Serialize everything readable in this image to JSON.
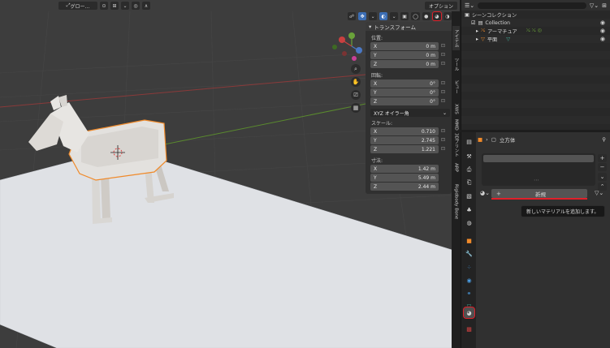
{
  "viewport_header": {
    "transform_orientation": "グロー...",
    "options_label": "オプション"
  },
  "npanel": {
    "title": "トランスフォーム",
    "location_label": "位置:",
    "location": [
      {
        "axis": "X",
        "value": "0 m"
      },
      {
        "axis": "Y",
        "value": "0 m"
      },
      {
        "axis": "Z",
        "value": "0 m"
      }
    ],
    "rotation_label": "回転:",
    "rotation": [
      {
        "axis": "X",
        "value": "0°"
      },
      {
        "axis": "Y",
        "value": "0°"
      },
      {
        "axis": "Z",
        "value": "0°"
      }
    ],
    "rotation_mode": "XYZ オイラー角",
    "scale_label": "スケール:",
    "scale": [
      {
        "axis": "X",
        "value": "0.710"
      },
      {
        "axis": "Y",
        "value": "2.745"
      },
      {
        "axis": "Z",
        "value": "1.221"
      }
    ],
    "dimensions_label": "寸法:",
    "dimensions": [
      {
        "axis": "X",
        "value": "1.42 m"
      },
      {
        "axis": "Y",
        "value": "5.49 m"
      },
      {
        "axis": "Z",
        "value": "2.44 m"
      }
    ]
  },
  "sidebar_tabs": [
    "アイテム",
    "ツール",
    "ビュー",
    "3Dプリント",
    "Rigidbody Bone",
    "ARP",
    "XWS",
    "MMD"
  ],
  "outliner": {
    "title": "シーンコレクション",
    "items": [
      {
        "label": "Collection"
      },
      {
        "label": "アーマチュア"
      },
      {
        "label": "平面"
      }
    ]
  },
  "properties": {
    "object_name": "立方体",
    "new_material_button": "新規",
    "tooltip": "新しいマテリアルを追加します。"
  },
  "colors": {
    "selection_outline": "#f08a2a",
    "highlight_red": "#e0202a",
    "accent_blue": "#3c6eb4"
  }
}
